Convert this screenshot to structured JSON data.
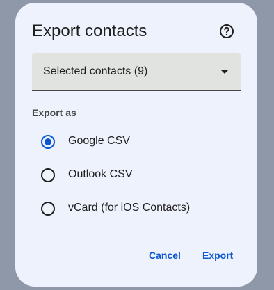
{
  "dialog": {
    "title": "Export contacts",
    "help_icon": "help-circle-icon",
    "select": {
      "value": "Selected contacts (9)",
      "icon": "dropdown-caret-icon"
    },
    "section_label": "Export as",
    "options": [
      {
        "label": "Google CSV",
        "checked": true
      },
      {
        "label": "Outlook CSV",
        "checked": false
      },
      {
        "label": "vCard (for iOS Contacts)",
        "checked": false
      }
    ],
    "actions": {
      "cancel_label": "Cancel",
      "export_label": "Export"
    }
  },
  "colors": {
    "backdrop": "#8f98a8",
    "surface": "#eef2fd",
    "accent": "#0b57d0"
  }
}
